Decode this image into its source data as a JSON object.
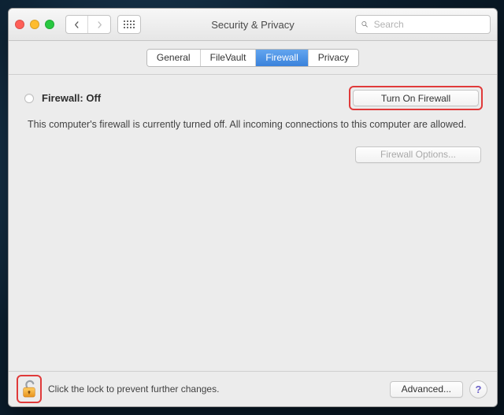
{
  "window": {
    "title": "Security & Privacy"
  },
  "search": {
    "placeholder": "Search",
    "value": ""
  },
  "tabs": {
    "general": "General",
    "filevault": "FileVault",
    "firewall": "Firewall",
    "privacy": "Privacy",
    "active": "firewall"
  },
  "firewall": {
    "status_label": "Firewall: Off",
    "turn_on_label": "Turn On Firewall",
    "description": "This computer's firewall is currently turned off. All incoming connections to this computer are allowed.",
    "options_label": "Firewall Options...",
    "options_enabled": false
  },
  "footer": {
    "lock_hint": "Click the lock to prevent further changes.",
    "advanced_label": "Advanced...",
    "help_label": "?"
  },
  "colors": {
    "annotation": "#e03a3a",
    "accent": "#3a82db"
  }
}
